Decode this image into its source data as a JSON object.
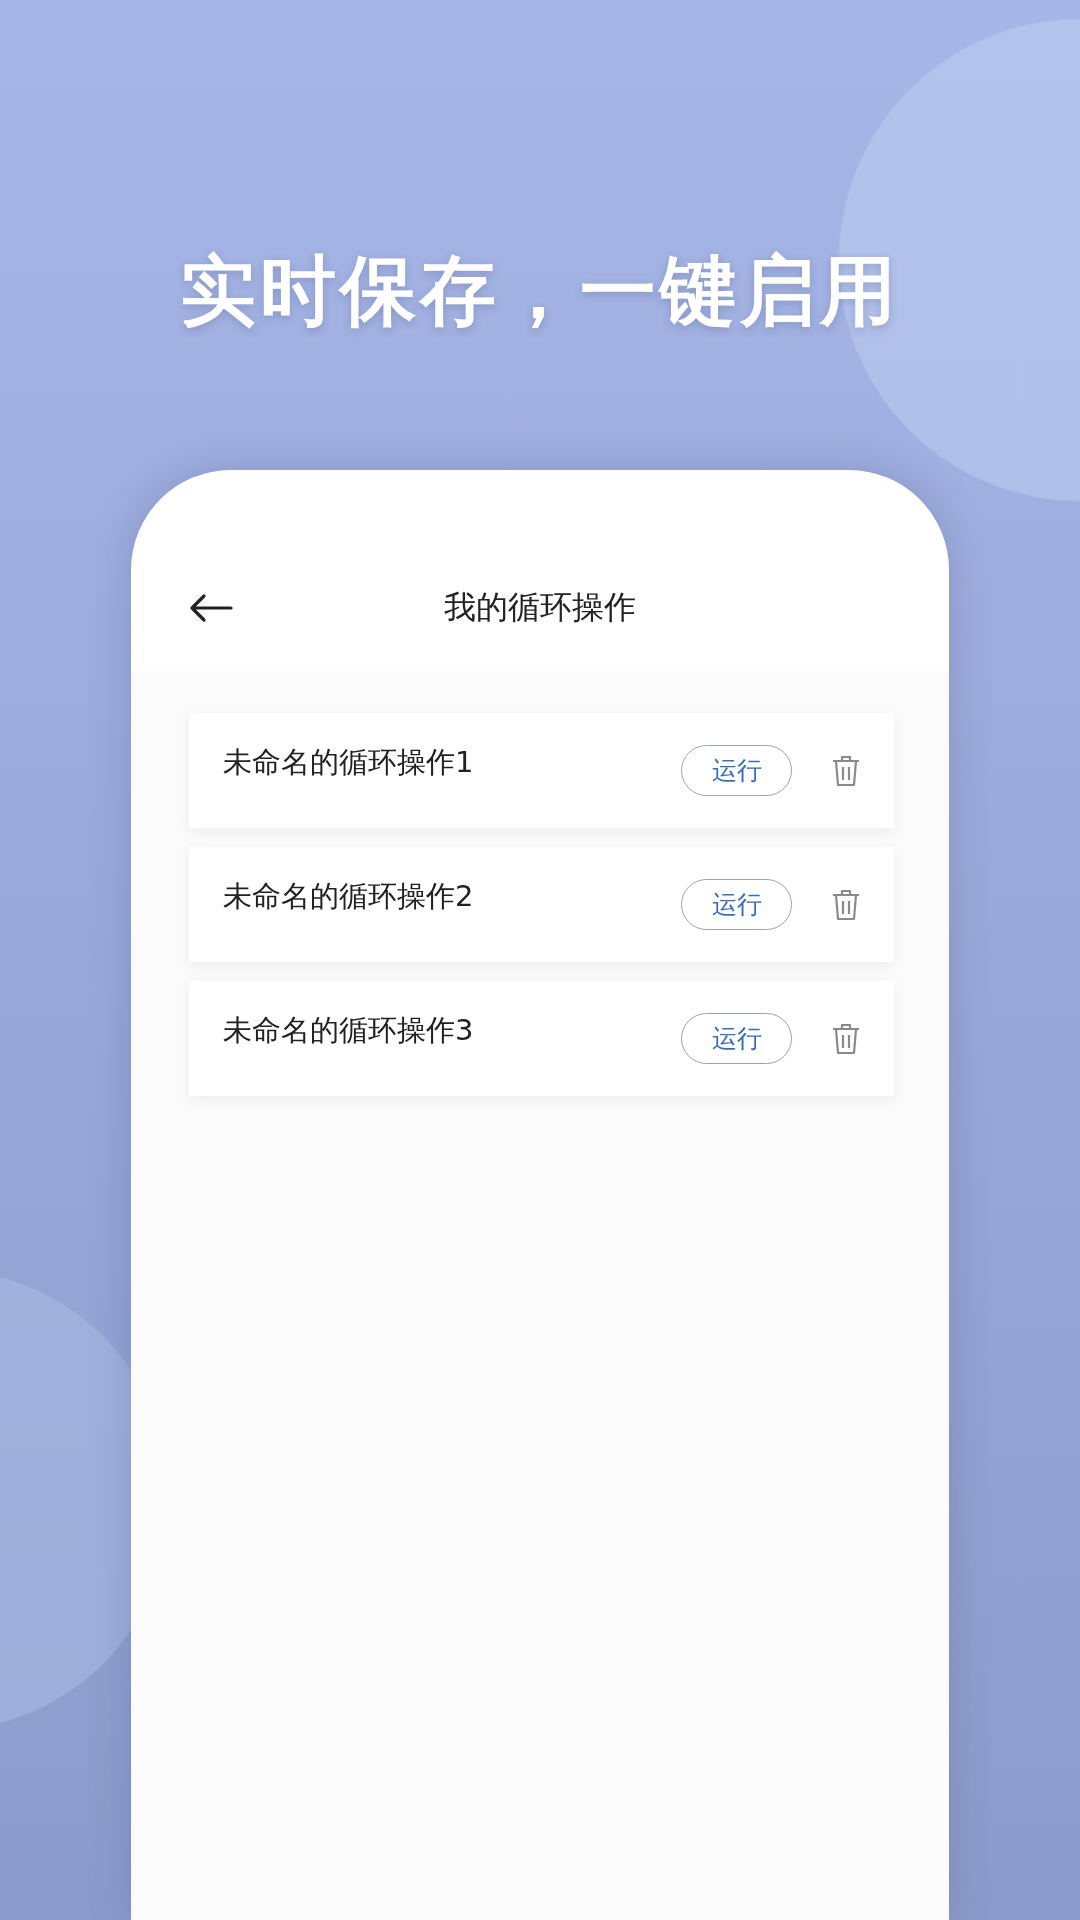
{
  "headline": "实时保存，一键启用",
  "screen": {
    "title": "我的循环操作",
    "items": [
      {
        "name": "未命名的循环操作1",
        "action": "运行"
      },
      {
        "name": "未命名的循环操作2",
        "action": "运行"
      },
      {
        "name": "未命名的循环操作3",
        "action": "运行"
      }
    ]
  }
}
